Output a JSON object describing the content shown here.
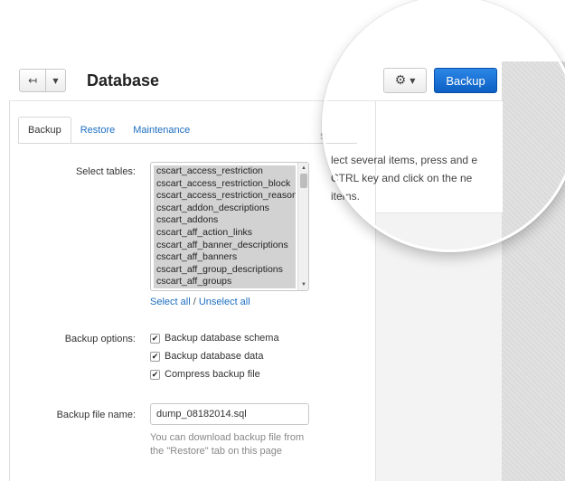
{
  "header": {
    "title": "Database",
    "back_icon": "↤",
    "caret_icon": "▼",
    "gear_icon": "⚙",
    "primary_button": "Backup"
  },
  "tabs": [
    {
      "label": "Backup",
      "active": true
    },
    {
      "label": "Restore",
      "active": false
    },
    {
      "label": "Maintenance",
      "active": false
    }
  ],
  "form": {
    "select_tables_label": "Select tables:",
    "tables": [
      "cscart_access_restriction",
      "cscart_access_restriction_block",
      "cscart_access_restriction_reason",
      "cscart_addon_descriptions",
      "cscart_addons",
      "cscart_aff_action_links",
      "cscart_aff_banner_descriptions",
      "cscart_aff_banners",
      "cscart_aff_group_descriptions",
      "cscart_aff_groups"
    ],
    "select_all": "Select all",
    "separator": "/",
    "unselect_all": "Unselect all",
    "backup_options_label": "Backup options:",
    "options": [
      {
        "label": "Backup database schema",
        "checked": true
      },
      {
        "label": "Backup database data",
        "checked": true
      },
      {
        "label": "Compress backup file",
        "checked": true
      }
    ],
    "file_name_label": "Backup file name:",
    "file_name_value": "dump_08182014.sql",
    "file_help": "You can download backup file from the \"Restore\" tab on this page"
  },
  "sidebar": {
    "heading": "s",
    "hint": "lect several items, press and e CTRL key and click on the ne items."
  },
  "colors": {
    "primary": "#0d5fc4",
    "link": "#1d6ec0"
  }
}
